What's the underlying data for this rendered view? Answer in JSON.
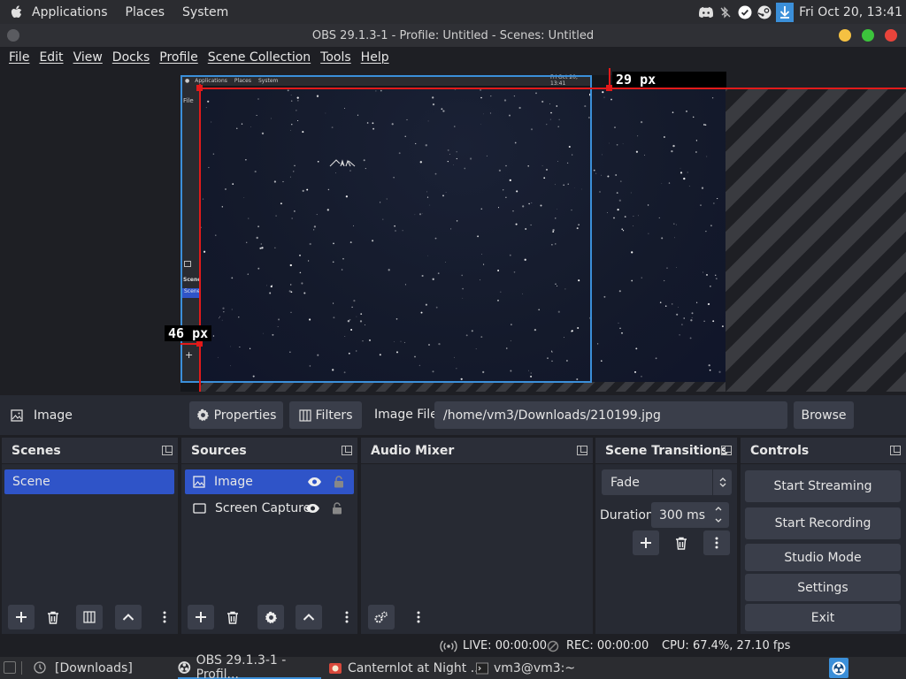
{
  "sysbar": {
    "menus": [
      "Applications",
      "Places",
      "System"
    ],
    "clock": "Fri Oct 20, 13:41"
  },
  "window": {
    "title": "OBS 29.1.3-1 - Profile: Untitled - Scenes: Untitled"
  },
  "menubar": [
    "File",
    "Edit",
    "View",
    "Docks",
    "Profile",
    "Scene Collection",
    "Tools",
    "Help"
  ],
  "preview": {
    "top_offset_label": "29 px",
    "left_offset_label": "46 px",
    "mini_menus": [
      "Applications",
      "Places",
      "System"
    ],
    "mini_clock": "Fri Oct 20, 13:41",
    "mini_file": "File",
    "mini_scenes": "Scene",
    "mini_scene": "Scene"
  },
  "propbar": {
    "source_name": "Image",
    "properties_label": "Properties",
    "filters_label": "Filters",
    "image_file_label": "Image File",
    "image_file_path": "/home/vm3/Downloads/210199.jpg",
    "browse_label": "Browse"
  },
  "scenes": {
    "title": "Scenes",
    "items": [
      "Scene"
    ]
  },
  "sources": {
    "title": "Sources",
    "items": [
      {
        "name": "Image",
        "selected": true
      },
      {
        "name": "Screen Capture",
        "selected": false
      }
    ]
  },
  "audio_mixer": {
    "title": "Audio Mixer"
  },
  "transitions": {
    "title": "Scene Transitions",
    "selected": "Fade",
    "duration_label": "Duration",
    "duration_value": "300 ms"
  },
  "controls": {
    "title": "Controls",
    "buttons": [
      "Start Streaming",
      "Start Recording",
      "Studio Mode",
      "Settings",
      "Exit"
    ]
  },
  "status": {
    "live": "LIVE: 00:00:00",
    "rec": "REC: 00:00:00",
    "cpu": "CPU: 67.4%, 27.10 fps"
  },
  "taskbar": {
    "items": [
      "[Downloads]",
      "OBS 29.1.3-1 - Profil...",
      "Canternlot at Night ...",
      "vm3@vm3:~"
    ]
  },
  "colors": {
    "accent": "#3b8fd9",
    "selection": "#2f54c8",
    "guide": "#e21a1a",
    "dock_bg": "#272a33"
  }
}
